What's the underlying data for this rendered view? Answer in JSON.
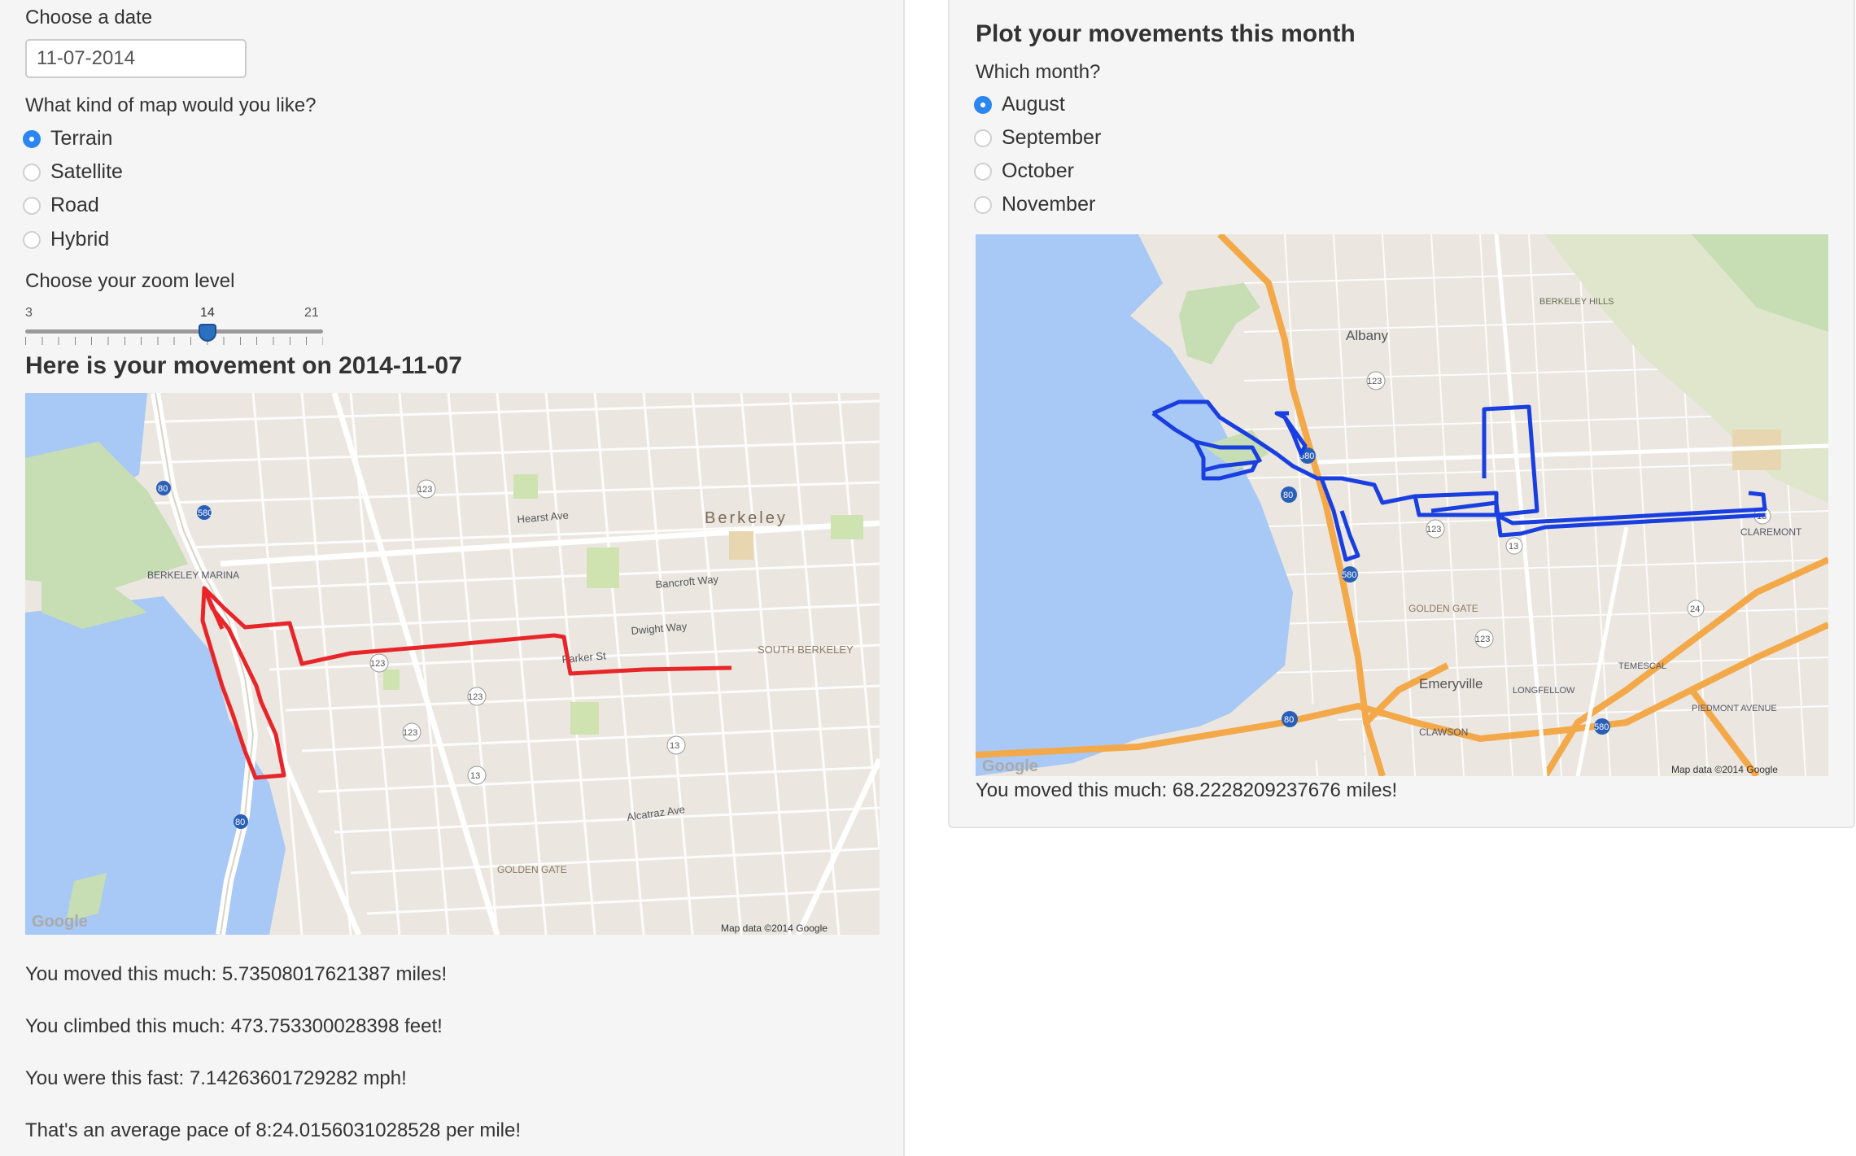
{
  "left": {
    "date_label": "Choose a date",
    "date_value": "11-07-2014",
    "map_type_label": "What kind of map would you like?",
    "map_types": [
      "Terrain",
      "Satellite",
      "Road",
      "Hybrid"
    ],
    "map_type_selected": "Terrain",
    "zoom_label": "Choose your zoom level",
    "zoom": {
      "min": "3",
      "max": "21",
      "value": "14"
    },
    "heading": "Here is your movement on 2014-11-07",
    "route_color": "#e8262a",
    "map_labels": {
      "berkeley": "Berkeley",
      "south_berkeley": "SOUTH BERKELEY",
      "berkeley_marina": "BERKELEY MARINA",
      "golden_gate": "GOLDEN GATE",
      "dwight_way": "Dwight Way",
      "parker_st": "Parker St",
      "hearst_ave": "Hearst Ave",
      "bancroft_way": "Bancroft Way",
      "ashby": "Alcatraz Ave",
      "google": "Google",
      "map_data": "Map data ©2014 Google"
    },
    "stats": {
      "distance": "You moved this much: 5.73508017621387 miles!",
      "climb": "You climbed this much: 473.753300028398 feet!",
      "speed": "You were this fast: 7.14263601729282 mph!",
      "pace": "That's an average pace of 8:24.0156031028528 per mile!"
    }
  },
  "right": {
    "heading": "Plot your movements this month",
    "month_label": "Which month?",
    "months": [
      "August",
      "September",
      "October",
      "November"
    ],
    "month_selected": "August",
    "route_color": "#1a3fe0",
    "map_labels": {
      "albany": "Albany",
      "emeryville": "Emeryville",
      "berkeley_hills": "BERKELEY HILLS",
      "golden_gate": "GOLDEN GATE",
      "claremont": "CLAREMONT",
      "piedmont_ave": "PIEDMONT AVENUE",
      "temescal": "TEMESCAL",
      "longfellow": "LONGFELLOW",
      "clawson": "CLAWSON",
      "google": "Google",
      "map_data": "Map data ©2014 Google"
    },
    "distance": "You moved this much: 68.2228209237676 miles!"
  }
}
